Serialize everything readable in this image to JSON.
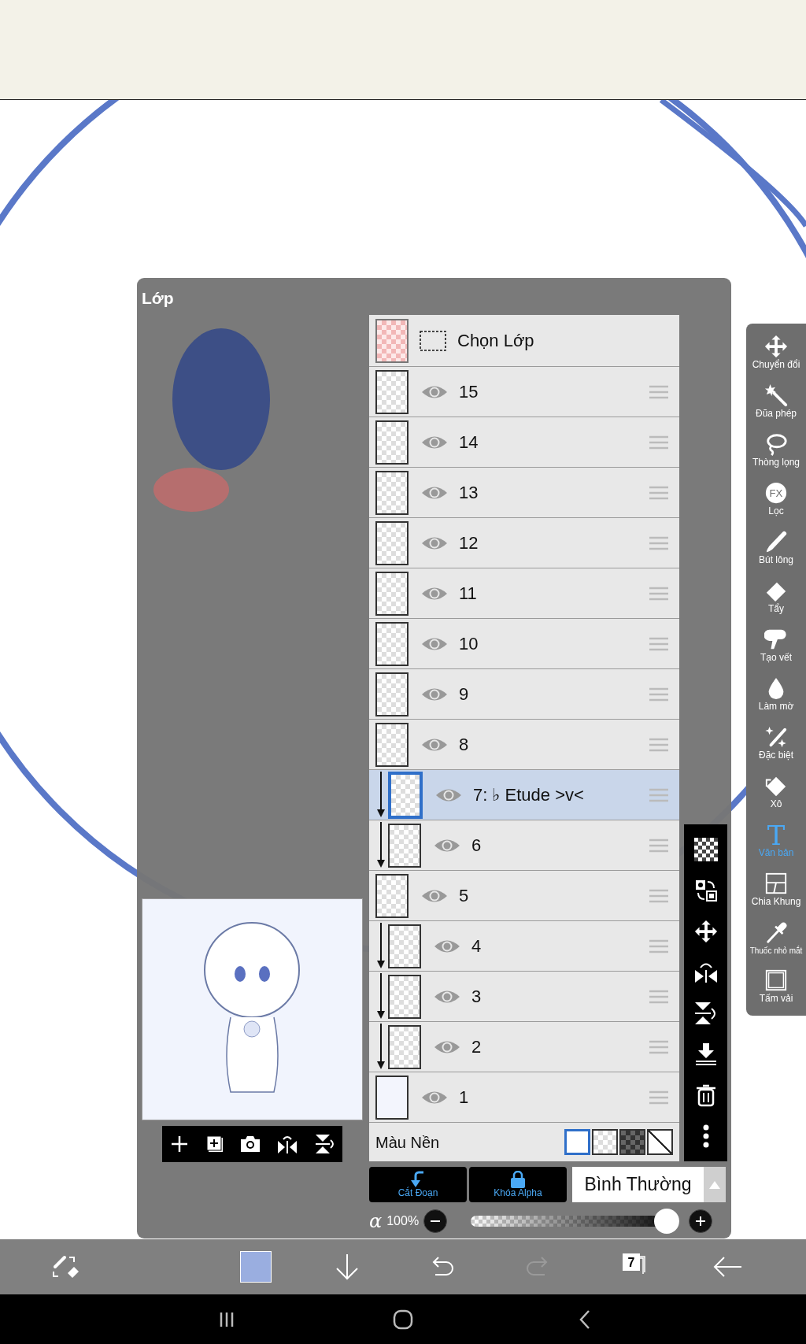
{
  "panel": {
    "title": "Lớp"
  },
  "select_layer": {
    "label": "Chọn Lớp"
  },
  "layers": [
    {
      "name": "15",
      "selected": false,
      "clipped": false,
      "opaque": false
    },
    {
      "name": "14",
      "selected": false,
      "clipped": false,
      "opaque": false
    },
    {
      "name": "13",
      "selected": false,
      "clipped": false,
      "opaque": false
    },
    {
      "name": "12",
      "selected": false,
      "clipped": false,
      "opaque": false
    },
    {
      "name": "11",
      "selected": false,
      "clipped": false,
      "opaque": false
    },
    {
      "name": "10",
      "selected": false,
      "clipped": false,
      "opaque": false
    },
    {
      "name": "9",
      "selected": false,
      "clipped": false,
      "opaque": false
    },
    {
      "name": "8",
      "selected": false,
      "clipped": false,
      "opaque": false
    },
    {
      "name": "7: ♭ Etude >v<",
      "selected": true,
      "clipped": true,
      "opaque": false
    },
    {
      "name": "6",
      "selected": false,
      "clipped": true,
      "opaque": false
    },
    {
      "name": "5",
      "selected": false,
      "clipped": false,
      "opaque": false
    },
    {
      "name": "4",
      "selected": false,
      "clipped": true,
      "opaque": false
    },
    {
      "name": "3",
      "selected": false,
      "clipped": true,
      "opaque": false
    },
    {
      "name": "2",
      "selected": false,
      "clipped": true,
      "opaque": false
    },
    {
      "name": "1",
      "selected": false,
      "clipped": false,
      "opaque": true
    }
  ],
  "background": {
    "label": "Màu Nền",
    "options": [
      {
        "kind": "white",
        "selected": true
      },
      {
        "kind": "transparent",
        "selected": false
      },
      {
        "kind": "dark",
        "selected": false
      },
      {
        "kind": "none",
        "selected": false
      }
    ]
  },
  "clip_button": {
    "label": "Cắt Đoạn"
  },
  "alpha_lock_button": {
    "label": "Khóa Alpha"
  },
  "blend_mode": {
    "value": "Bình Thường"
  },
  "opacity": {
    "symbol": "α",
    "reading": "100%",
    "level": 1
  },
  "tools": [
    {
      "kind": "transform",
      "label": "Chuyển đổi",
      "selected": false
    },
    {
      "kind": "magic_wand",
      "label": "Đũa phép",
      "selected": false
    },
    {
      "kind": "lasso",
      "label": "Thòng lọng",
      "selected": false
    },
    {
      "kind": "filter",
      "label": "Lọc",
      "icon_text": "FX",
      "selected": false
    },
    {
      "kind": "brush",
      "label": "Bút lông",
      "selected": false
    },
    {
      "kind": "eraser",
      "label": "Tẩy",
      "selected": false
    },
    {
      "kind": "smudge",
      "label": "Tạo vết",
      "selected": false
    },
    {
      "kind": "blur",
      "label": "Làm mờ",
      "selected": false
    },
    {
      "kind": "special",
      "label": "Đặc biệt",
      "selected": false
    },
    {
      "kind": "fill",
      "label": "Xô",
      "selected": false
    },
    {
      "kind": "text",
      "label": "Văn bản",
      "icon_text": "T",
      "selected": true
    },
    {
      "kind": "frame",
      "label": "Chia Khung",
      "selected": false
    },
    {
      "kind": "eyedropper",
      "label": "Thuốc nhỏ mắt",
      "selected": false
    },
    {
      "kind": "canvas",
      "label": "Tấm vải",
      "selected": false
    }
  ],
  "toolbar": {
    "color": "#9aaee0",
    "layer_count": "7",
    "redo_disabled": true
  }
}
